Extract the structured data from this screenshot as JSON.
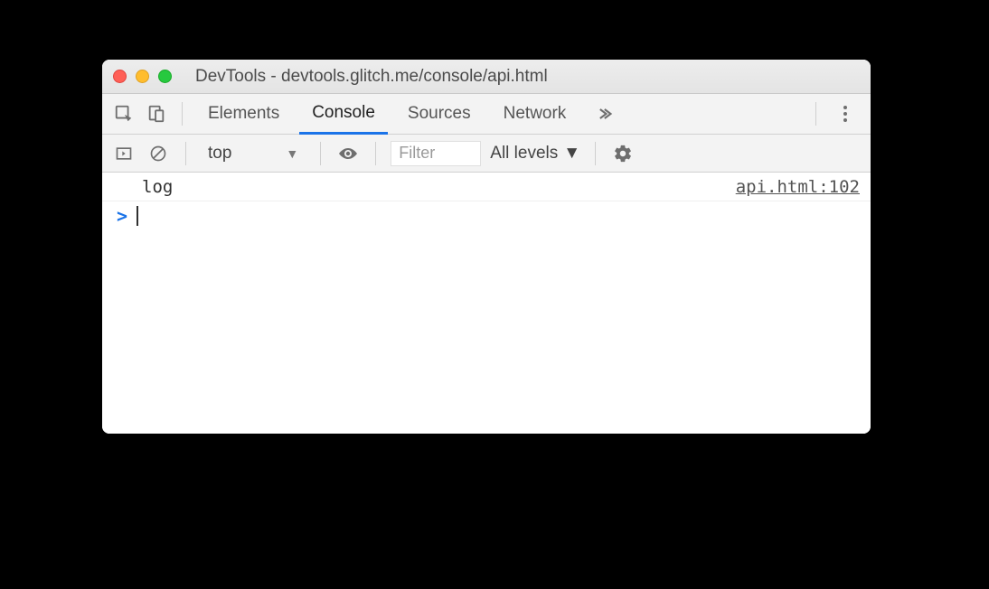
{
  "window": {
    "title": "DevTools - devtools.glitch.me/console/api.html"
  },
  "tabs": {
    "elements": "Elements",
    "console": "Console",
    "sources": "Sources",
    "network": "Network"
  },
  "toolbar": {
    "context": "top",
    "filter_placeholder": "Filter",
    "levels_label": "All levels"
  },
  "console": {
    "entries": [
      {
        "message": "log",
        "source": "api.html:102"
      }
    ],
    "prompt": ">"
  }
}
